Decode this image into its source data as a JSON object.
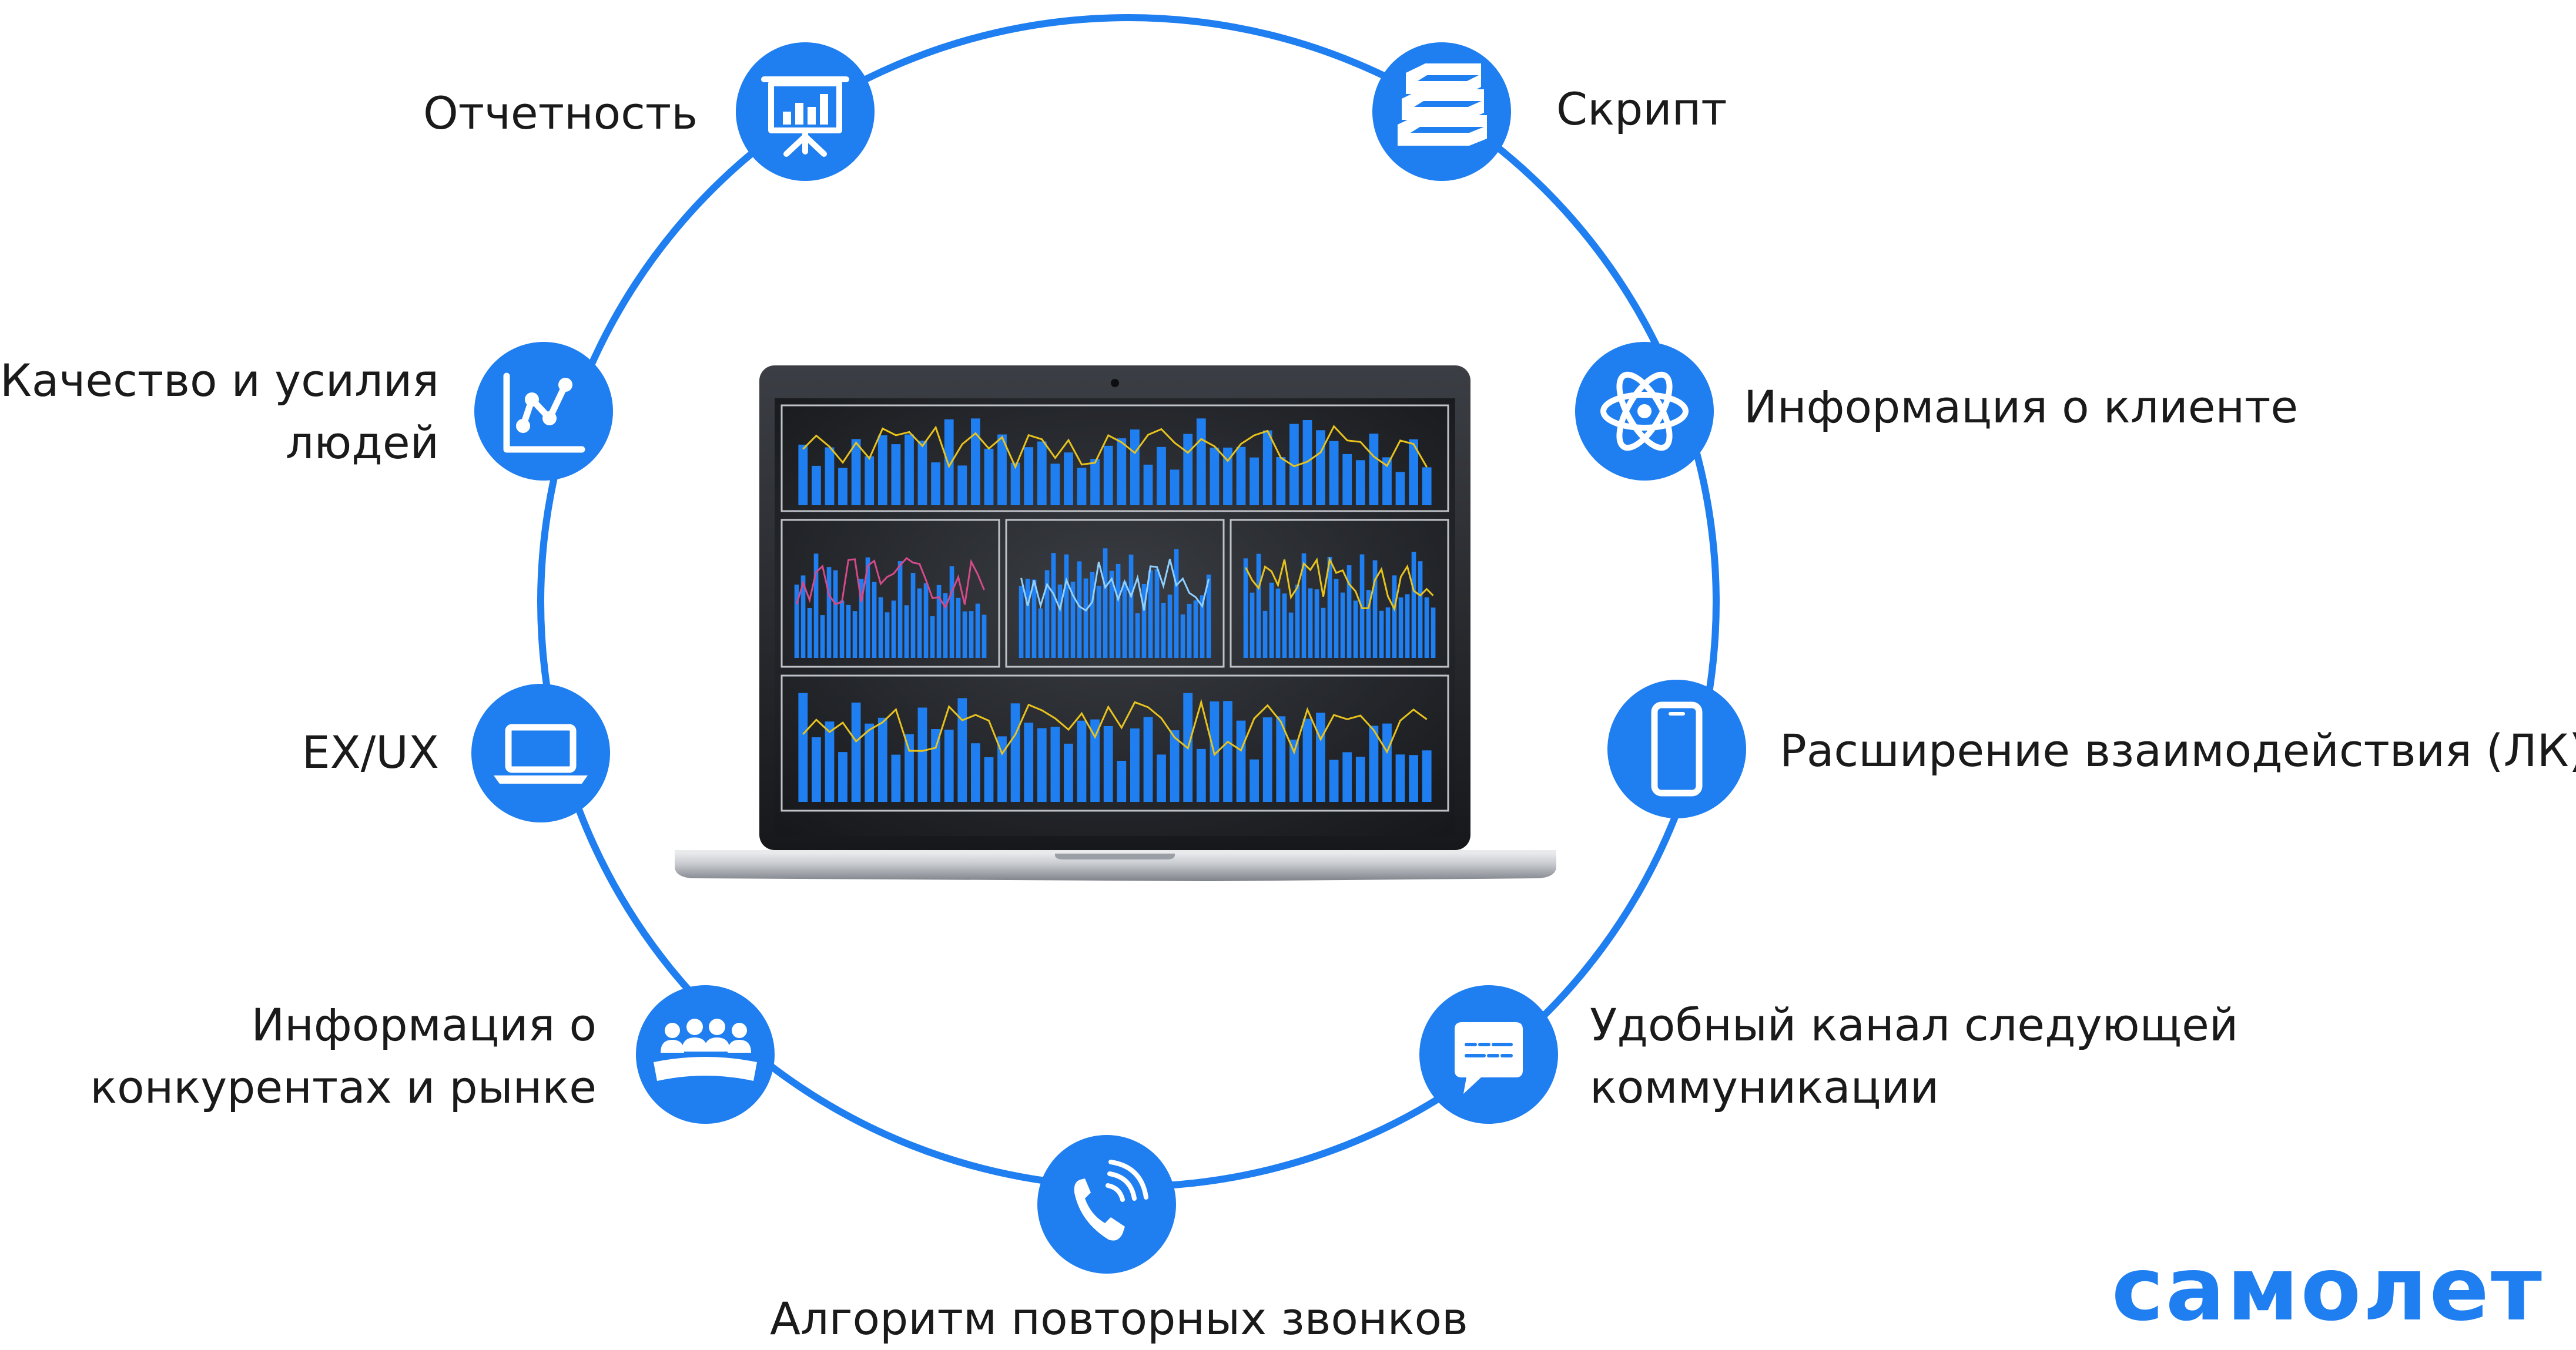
{
  "nodes": [
    {
      "id": "reporting",
      "icon": "presentation-chart-icon",
      "lines": [
        "Отчетность"
      ]
    },
    {
      "id": "script",
      "icon": "books-icon",
      "lines": [
        "Скрипт"
      ]
    },
    {
      "id": "quality",
      "icon": "line-chart-icon",
      "lines": [
        "Качество и усилия",
        "людей"
      ]
    },
    {
      "id": "client-info",
      "icon": "atom-icon",
      "lines": [
        "Информация о клиенте"
      ]
    },
    {
      "id": "ex-ux",
      "icon": "laptop-icon",
      "lines": [
        "EX/UX"
      ]
    },
    {
      "id": "lk",
      "icon": "smartphone-icon",
      "lines": [
        "Расширение взаимодействия (ЛК)"
      ]
    },
    {
      "id": "competitors",
      "icon": "group-icon",
      "lines": [
        "Информация о",
        "конкурентах и рынке"
      ]
    },
    {
      "id": "channel",
      "icon": "chat-bubble-icon",
      "lines": [
        "Удобный канал следующей",
        "коммуникации"
      ]
    },
    {
      "id": "recall",
      "icon": "phone-ringing-icon",
      "lines": [
        "Алгоритм повторных звонков"
      ]
    }
  ],
  "center": {
    "icon": "laptop-dashboard-icon"
  },
  "logo": {
    "text": "самолет"
  },
  "colors": {
    "accent": "#1f7ef0",
    "ring": "#1f7ef0",
    "text": "#1a1a1a",
    "screen": "#1c1e22",
    "bars": "#1f7ef0",
    "line": "#e8c31e"
  }
}
